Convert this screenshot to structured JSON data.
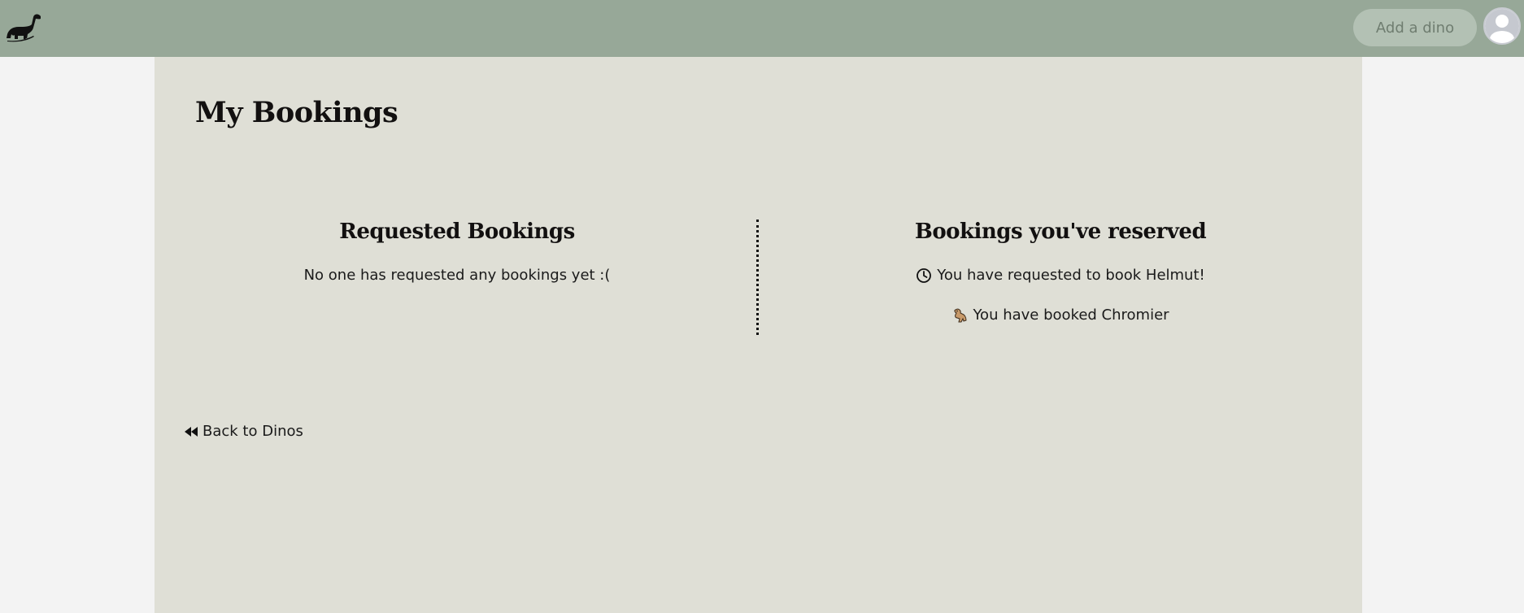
{
  "navbar": {
    "logo_icon": "dinosaur-logo-icon",
    "add_dino_label": "Add a dino",
    "avatar_icon": "user-avatar-icon"
  },
  "page": {
    "title": "My Bookings"
  },
  "requested": {
    "heading": "Requested Bookings",
    "empty_message": "No one has requested any bookings yet :("
  },
  "reserved": {
    "heading": "Bookings you've reserved",
    "items": [
      {
        "icon": "clock-icon",
        "text": "You have requested to book Helmut!"
      },
      {
        "icon": "dinosaur-icon",
        "text": "You have booked Chromier"
      }
    ]
  },
  "back_link": {
    "icon": "rewind-icon",
    "label": "Back to Dinos"
  },
  "colors": {
    "navbar": "#97a898",
    "content_bg": "#dfdfd6",
    "page_bg": "#f3f3f3",
    "button_bg": "#b3c1b4"
  }
}
